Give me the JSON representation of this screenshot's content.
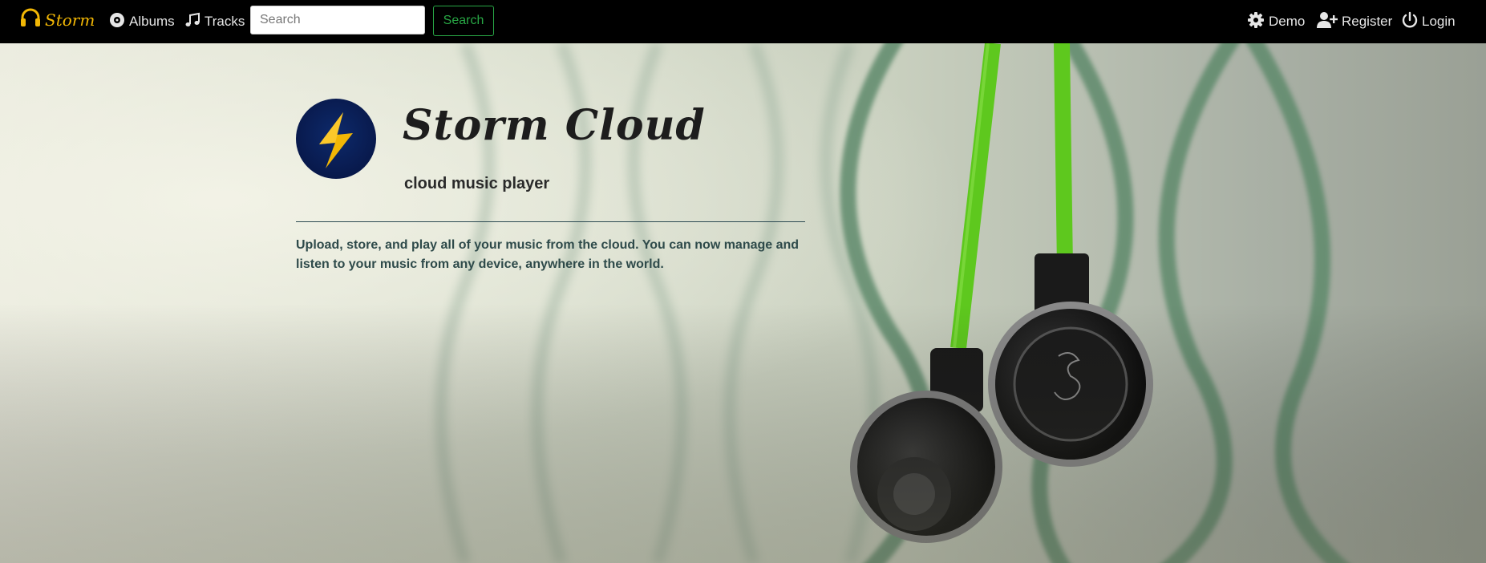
{
  "brand": {
    "name": "Storm",
    "accent": "#f2b705"
  },
  "nav": {
    "albums_label": "Albums",
    "tracks_label": "Tracks",
    "search_placeholder": "Search",
    "search_button_label": "Search",
    "demo_label": "Demo",
    "register_label": "Register",
    "login_label": "Login"
  },
  "hero": {
    "title": "Storm Cloud",
    "subtitle": "cloud music player",
    "description": "Upload, store, and play all of your music from the cloud. You can now manage and listen to your music from any device, anywhere in the world."
  },
  "colors": {
    "navbar_bg": "#000000",
    "search_button": "#28a745",
    "logo_bg": "#0d2a6b",
    "bolt": "#f2b705",
    "earbud_cable": "#5ec81e"
  },
  "icons": [
    "headphones-icon",
    "album-icon",
    "music-note-icon",
    "gear-icon",
    "user-plus-icon",
    "power-icon",
    "lightning-bolt-icon"
  ]
}
